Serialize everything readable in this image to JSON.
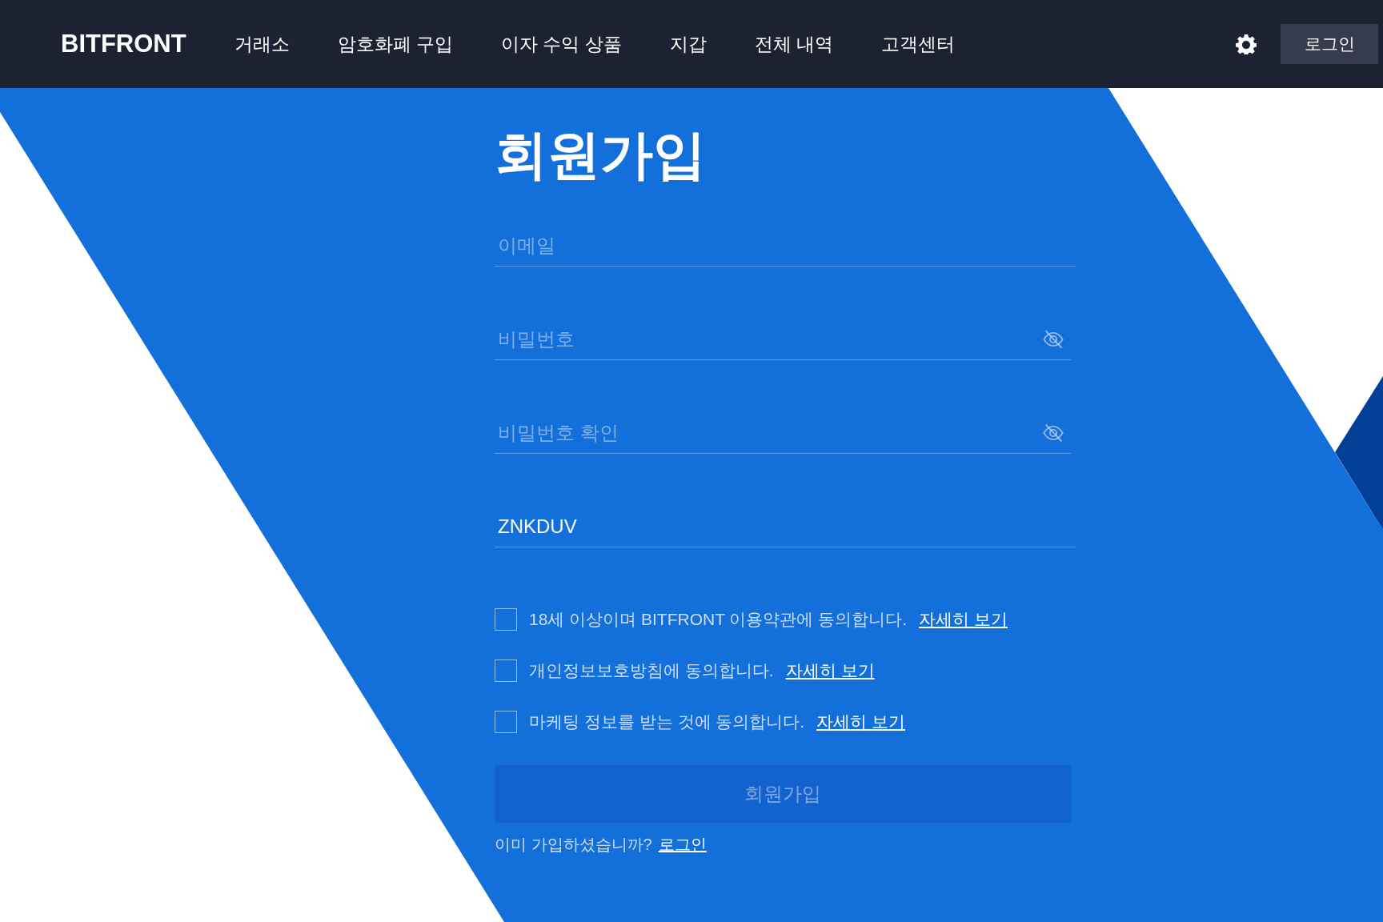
{
  "header": {
    "logo": "BITFRONT",
    "nav": [
      {
        "label": "거래소"
      },
      {
        "label": "암호화폐 구입"
      },
      {
        "label": "이자 수익 상품"
      },
      {
        "label": "지갑"
      },
      {
        "label": "전체 내역"
      },
      {
        "label": "고객센터"
      }
    ],
    "login": "로그인"
  },
  "form": {
    "title": "회원가입",
    "fields": [
      {
        "kind": "text",
        "placeholder": "이메일"
      },
      {
        "kind": "password",
        "placeholder": "비밀번호"
      },
      {
        "kind": "password",
        "placeholder": "비밀번호 확인"
      },
      {
        "kind": "text",
        "value": "ZNKDUV"
      }
    ],
    "agreements": [
      {
        "text": "18세 이상이며 BITFRONT 이용약관에 동의합니다.",
        "link": "자세히 보기",
        "checked": false
      },
      {
        "text": "개인정보보호방침에 동의합니다.",
        "link": "자세히 보기",
        "checked": false
      },
      {
        "text": "마케팅 정보를 받는 것에 동의합니다.",
        "link": "자세히 보기",
        "checked": false
      }
    ],
    "submit": {
      "label": "회원가입",
      "disabled": true
    },
    "footer": {
      "text": "이미 가입하셨습니까?",
      "link": "로그인"
    }
  }
}
